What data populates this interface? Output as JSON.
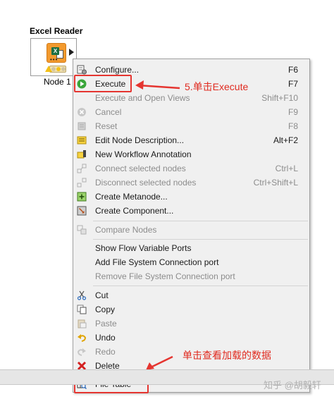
{
  "node": {
    "title": "Excel Reader",
    "label": "Node 1",
    "icon": "excel-reader-icon",
    "accent": "#f39a2e"
  },
  "menu": {
    "items": [
      {
        "label": "Configure...",
        "shortcut": "F6",
        "icon": "configure-icon",
        "disabled": false
      },
      {
        "label": "Execute",
        "shortcut": "F7",
        "icon": "execute-icon",
        "disabled": false
      },
      {
        "label": "Execute and Open Views",
        "shortcut": "Shift+F10",
        "icon": "",
        "disabled": true
      },
      {
        "label": "Cancel",
        "shortcut": "F9",
        "icon": "cancel-icon",
        "disabled": true
      },
      {
        "label": "Reset",
        "shortcut": "F8",
        "icon": "reset-icon",
        "disabled": true
      },
      {
        "label": "Edit Node Description...",
        "shortcut": "Alt+F2",
        "icon": "edit-description-icon",
        "disabled": false
      },
      {
        "label": "New Workflow Annotation",
        "shortcut": "",
        "icon": "annotation-icon",
        "disabled": false
      },
      {
        "label": "Connect selected nodes",
        "shortcut": "Ctrl+L",
        "icon": "connect-icon",
        "disabled": true
      },
      {
        "label": "Disconnect selected nodes",
        "shortcut": "Ctrl+Shift+L",
        "icon": "disconnect-icon",
        "disabled": true
      },
      {
        "label": "Create Metanode...",
        "shortcut": "",
        "icon": "metanode-icon",
        "disabled": false
      },
      {
        "label": "Create Component...",
        "shortcut": "",
        "icon": "component-icon",
        "disabled": false
      },
      {
        "label": "Compare Nodes",
        "shortcut": "",
        "icon": "compare-icon",
        "disabled": true
      },
      {
        "label": "Show Flow Variable Ports",
        "shortcut": "",
        "icon": "",
        "disabled": false
      },
      {
        "label": "Add File System Connection port",
        "shortcut": "",
        "icon": "",
        "disabled": false
      },
      {
        "label": "Remove File System Connection port",
        "shortcut": "",
        "icon": "",
        "disabled": true
      },
      {
        "label": "Cut",
        "shortcut": "",
        "icon": "cut-icon",
        "disabled": false
      },
      {
        "label": "Copy",
        "shortcut": "",
        "icon": "copy-icon",
        "disabled": false
      },
      {
        "label": "Paste",
        "shortcut": "",
        "icon": "paste-icon",
        "disabled": true
      },
      {
        "label": "Undo",
        "shortcut": "",
        "icon": "undo-icon",
        "disabled": false
      },
      {
        "label": "Redo",
        "shortcut": "",
        "icon": "redo-icon",
        "disabled": true
      },
      {
        "label": "Delete",
        "shortcut": "",
        "icon": "delete-icon",
        "disabled": false
      },
      {
        "label": "File Table",
        "shortcut": "",
        "icon": "file-table-icon",
        "disabled": false
      }
    ]
  },
  "annotations": {
    "execute_note": "5.单击Execute",
    "file_table_note": "单击查看加载的数据",
    "color": "#e53530"
  },
  "watermark": "知乎 @胡毅轩"
}
